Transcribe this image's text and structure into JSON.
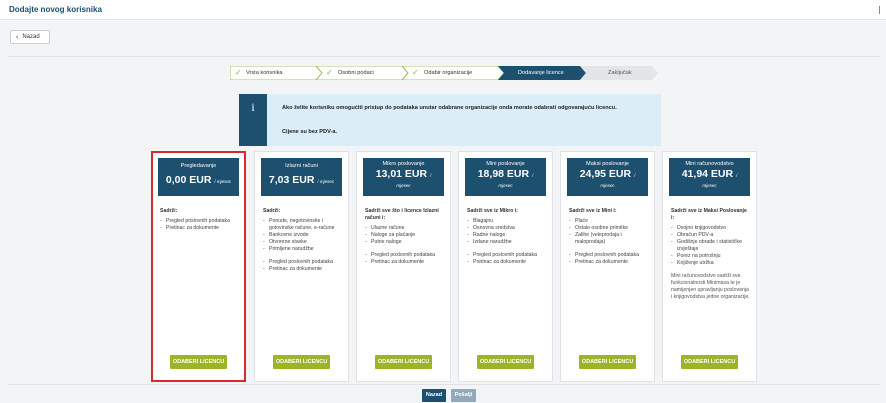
{
  "header": {
    "title": "Dodajte novog korisnika"
  },
  "back_button": {
    "label": "Nazad"
  },
  "wizard": {
    "steps": [
      {
        "label": "Vrsta korisnika",
        "state": "done"
      },
      {
        "label": "Osobni podaci",
        "state": "done"
      },
      {
        "label": "Odabir organizacije",
        "state": "done"
      },
      {
        "label": "Dodavanje licence",
        "state": "active"
      },
      {
        "label": "Zaključak",
        "state": "pending"
      }
    ]
  },
  "info": {
    "icon": "info-icon",
    "text": "Ako želite korisniku omogućiti pristup do podataka unutar odabrane organizacije onda morate odabrati odgovarajuću licencu.",
    "note": "Cijene su bez PDV-a."
  },
  "plans": [
    {
      "name": "Pregledavanje",
      "price": "0,00 EUR",
      "period": "/ mjesec",
      "content_title": "Sadrži:",
      "features": [
        "Pregled poslovnih podataka",
        "Pretinac za dokumente"
      ],
      "button": "ODABERI LICENCU",
      "selected": true
    },
    {
      "name": "Izlazni računi",
      "price": "7,03 EUR",
      "period": "/ mjesec",
      "content_title": "Sadrži:",
      "features": [
        "Ponude, negotovinske i gotovinske račune, e-račune",
        "Bankovne izvode",
        "Otvorene stavke",
        "Primljene narudžbe",
        "",
        "Pregled poslovnih podataka",
        "Pretinac za dokumente"
      ],
      "button": "ODABERI LICENCU"
    },
    {
      "name": "Mikro poslovanje",
      "price": "13,01 EUR",
      "period_short": "/",
      "period": "mjesec",
      "content_title": "Sadrži sve što i licence Izlazni računi i:",
      "features": [
        "Ulazne račune",
        "Naloge za plaćanje",
        "Putne naloge",
        "",
        "Pregled poslovnih podataka",
        "Pretinac za dokumente"
      ],
      "button": "ODABERI LICENCU"
    },
    {
      "name": "Mini poslovanje",
      "price": "18,98 EUR",
      "period_short": "/",
      "period": "mjesec",
      "content_title": "Sadrži sve iz Mikro i:",
      "features": [
        "Blagajnu",
        "Osnovna sredstva",
        "Radne naloge",
        "Izdane narudžbe",
        "",
        "Pregled poslovnih podataka",
        "Pretinac za dokumente"
      ],
      "button": "ODABERI LICENCU"
    },
    {
      "name": "Maksi poslovanje",
      "price": "24,95 EUR",
      "period_short": "/",
      "period": "mjesec",
      "content_title": "Sadrži sve iz Mini i:",
      "features": [
        "Plaće",
        "Ostale osobne primitke",
        "Zalihe (veleprodaja i maloprodaja)",
        "",
        "Pregled poslovnih podataka",
        "Pretinac za dokumente"
      ],
      "button": "ODABERI LICENCU"
    },
    {
      "name": "Mini računovodstvo",
      "price": "41,94 EUR",
      "period_short": "/",
      "period": "mjesec",
      "content_title": "Sadrži sve iz Maksi Poslovanje i:",
      "features": [
        "Dvojno knjigovodstvo",
        "Obračun PDV-a",
        "Godišnje obrade i statističke izvještaje",
        "Porez na potrošnju",
        "Knjiženje utržka"
      ],
      "note": "Mini računovodstvo sadrži sve funkcionalnosti Minimaxa te je namijenjen upravljanju poslovanja i knjigovodstva jedne organizacije.",
      "button": "ODABERI LICENCU"
    }
  ],
  "footer": {
    "back_label": "Nazad",
    "send_label": "Pošalji"
  },
  "colors": {
    "primary": "#1d4f6e",
    "accent": "#9bb526",
    "selected_border": "#d22d2d",
    "info_bg": "#dbedf7"
  }
}
